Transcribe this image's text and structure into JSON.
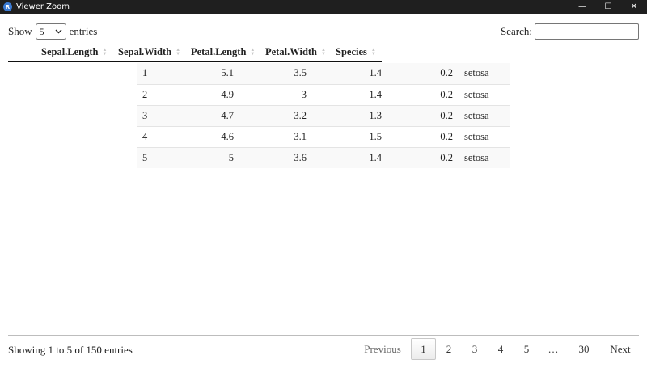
{
  "window": {
    "title": "Viewer Zoom",
    "icon_letter": "R",
    "controls": {
      "minimize": "—",
      "maximize": "☐",
      "close": "✕"
    }
  },
  "length_control": {
    "prefix": "Show",
    "selected": "5",
    "suffix": "entries"
  },
  "search": {
    "label": "Search:",
    "value": ""
  },
  "table": {
    "columns": [
      "Sepal.Length",
      "Sepal.Width",
      "Petal.Length",
      "Petal.Width",
      "Species"
    ],
    "rows": [
      [
        "1",
        "5.1",
        "3.5",
        "1.4",
        "0.2",
        "setosa"
      ],
      [
        "2",
        "4.9",
        "3",
        "1.4",
        "0.2",
        "setosa"
      ],
      [
        "3",
        "4.7",
        "3.2",
        "1.3",
        "0.2",
        "setosa"
      ],
      [
        "4",
        "4.6",
        "3.1",
        "1.5",
        "0.2",
        "setosa"
      ],
      [
        "5",
        "5",
        "3.6",
        "1.4",
        "0.2",
        "setosa"
      ]
    ]
  },
  "footer": {
    "info": "Showing 1 to 5 of 150 entries",
    "previous": "Previous",
    "pages": [
      "1",
      "2",
      "3",
      "4",
      "5",
      "…",
      "30"
    ],
    "current_page": "1",
    "next": "Next"
  }
}
